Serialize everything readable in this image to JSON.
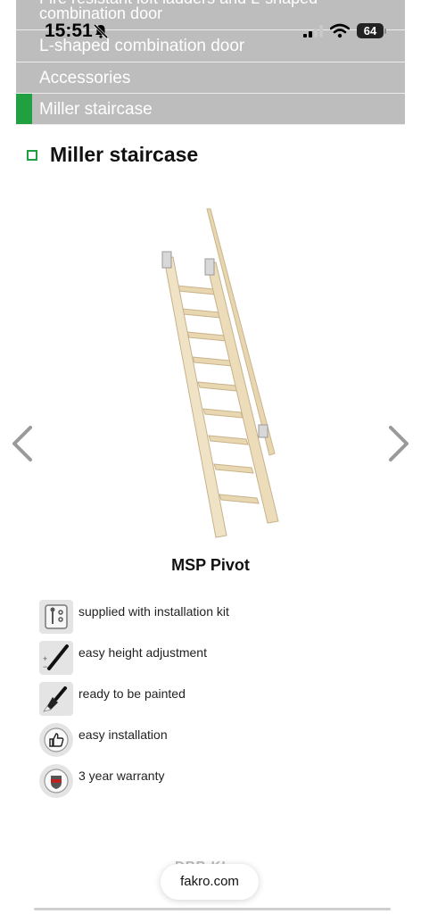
{
  "status_bar": {
    "time": "15:51",
    "battery": "64"
  },
  "menu": {
    "items": [
      {
        "label": "Fire resistant loft ladders and L-shaped combination door",
        "active": false
      },
      {
        "label": "L-shaped combination door",
        "active": false
      },
      {
        "label": "Accessories",
        "active": false
      },
      {
        "label": "Miller staircase",
        "active": true
      }
    ]
  },
  "section": {
    "title": "Miller staircase"
  },
  "product": {
    "name": "MSP Pivot"
  },
  "features": [
    {
      "icon": "installation-kit-icon",
      "text": "supplied with installation kit"
    },
    {
      "icon": "height-adjustment-icon",
      "text": "easy height adjustment"
    },
    {
      "icon": "paint-brush-icon",
      "text": "ready to be painted"
    },
    {
      "icon": "thumbs-up-icon",
      "text": "easy installation"
    },
    {
      "icon": "warranty-badge-icon",
      "text": "3 year warranty"
    }
  ],
  "browser": {
    "url": "fakro.com",
    "ghost_text": "DBB KI"
  },
  "colors": {
    "accent": "#20a040",
    "menu_bg": "#bdbdbd"
  }
}
